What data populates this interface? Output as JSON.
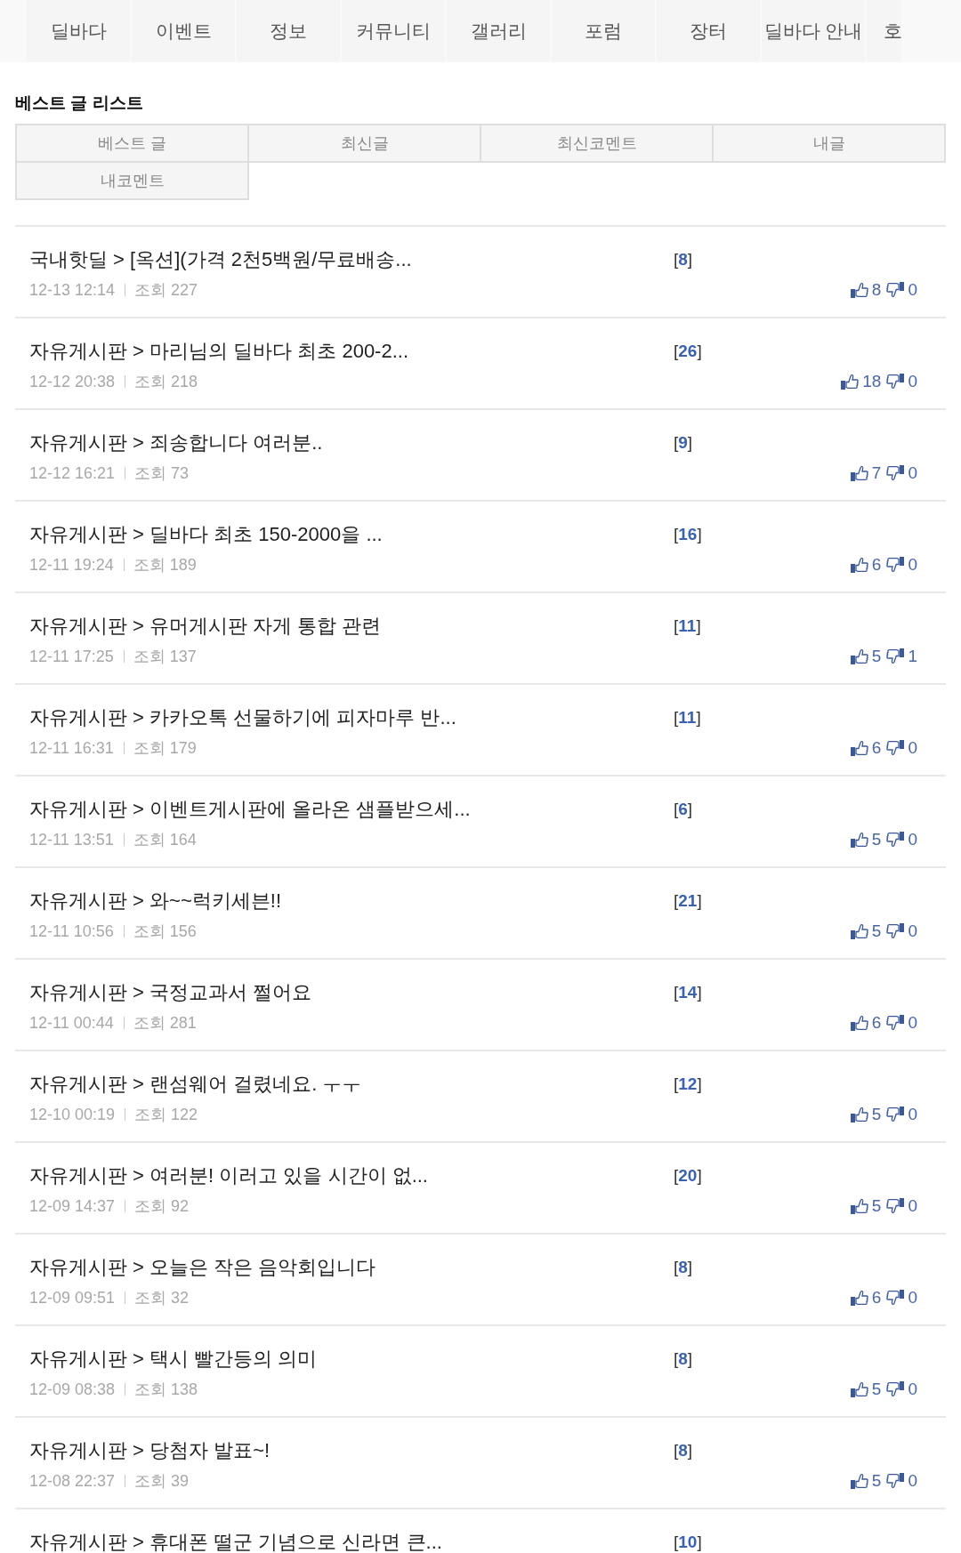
{
  "nav": {
    "items": [
      {
        "label": "딜바다"
      },
      {
        "label": "이벤트"
      },
      {
        "label": "정보"
      },
      {
        "label": "커뮤니티"
      },
      {
        "label": "갤러리"
      },
      {
        "label": "포럼"
      },
      {
        "label": "장터"
      },
      {
        "label": "딜바다 안내"
      },
      {
        "label": "호"
      }
    ]
  },
  "section_title": "베스트 글 리스트",
  "tabs": [
    {
      "label": "베스트 글"
    },
    {
      "label": "최신글"
    },
    {
      "label": "최신코멘트"
    },
    {
      "label": "내글"
    },
    {
      "label": "내코멘트"
    }
  ],
  "posts": [
    {
      "title": "국내핫딜 > [옥션](가격 2천5백원/무료배송...",
      "comments": "[**8**]",
      "date": "12-13 12:14",
      "views": "조회 227",
      "likes": "8",
      "dislikes": "0"
    },
    {
      "title": "자유게시판 > 마리님의 딜바다 최초 200-2...",
      "comments": "[**26**]",
      "date": "12-12 20:38",
      "views": "조회 218",
      "likes": "18",
      "dislikes": "0"
    },
    {
      "title": "자유게시판 > 죄송합니다 여러분..",
      "comments": "[**9**]",
      "date": "12-12 16:21",
      "views": "조회 73",
      "likes": "7",
      "dislikes": "0"
    },
    {
      "title": "자유게시판 > 딜바다 최초 150-2000을 ...",
      "comments": "[**16**]",
      "date": "12-11 19:24",
      "views": "조회 189",
      "likes": "6",
      "dislikes": "0"
    },
    {
      "title": "자유게시판 > 유머게시판 자게 통합 관련",
      "comments": "[**11**]",
      "date": "12-11 17:25",
      "views": "조회 137",
      "likes": "5",
      "dislikes": "1"
    },
    {
      "title": "자유게시판 > 카카오톡 선물하기에 피자마루 반...",
      "comments": "[**11**]",
      "date": "12-11 16:31",
      "views": "조회 179",
      "likes": "6",
      "dislikes": "0"
    },
    {
      "title": "자유게시판 > 이벤트게시판에 올라온 샘플받으세...",
      "comments": "[**6**]",
      "date": "12-11 13:51",
      "views": "조회 164",
      "likes": "5",
      "dislikes": "0"
    },
    {
      "title": "자유게시판 > 와~~럭키세븐!!",
      "comments": "[**21**]",
      "date": "12-11 10:56",
      "views": "조회 156",
      "likes": "5",
      "dislikes": "0"
    },
    {
      "title": "자유게시판 > 국정교과서 쩔어요",
      "comments": "[**14**]",
      "date": "12-11 00:44",
      "views": "조회 281",
      "likes": "6",
      "dislikes": "0"
    },
    {
      "title": "자유게시판 > 랜섬웨어 걸렸네요. ㅜㅜ",
      "comments": "[**12**]",
      "date": "12-10 00:19",
      "views": "조회 122",
      "likes": "5",
      "dislikes": "0"
    },
    {
      "title": "자유게시판 > 여러분! 이러고 있을 시간이 없...",
      "comments": "[**20**]",
      "date": "12-09 14:37",
      "views": "조회 92",
      "likes": "5",
      "dislikes": "0"
    },
    {
      "title": "자유게시판 > 오늘은 작은 음악회입니다",
      "comments": "[**8**]",
      "date": "12-09 09:51",
      "views": "조회 32",
      "likes": "6",
      "dislikes": "0"
    },
    {
      "title": "자유게시판 > 택시 빨간등의 의미",
      "comments": "[**8**]",
      "date": "12-09 08:38",
      "views": "조회 138",
      "likes": "5",
      "dislikes": "0"
    },
    {
      "title": "자유게시판 > 당첨자 발표~!",
      "comments": "[**8**]",
      "date": "12-08 22:37",
      "views": "조회 39",
      "likes": "5",
      "dislikes": "0"
    },
    {
      "title": "자유게시판 > 휴대폰 떨군 기념으로 신라면 큰...",
      "comments": "[**10**]"
    }
  ]
}
